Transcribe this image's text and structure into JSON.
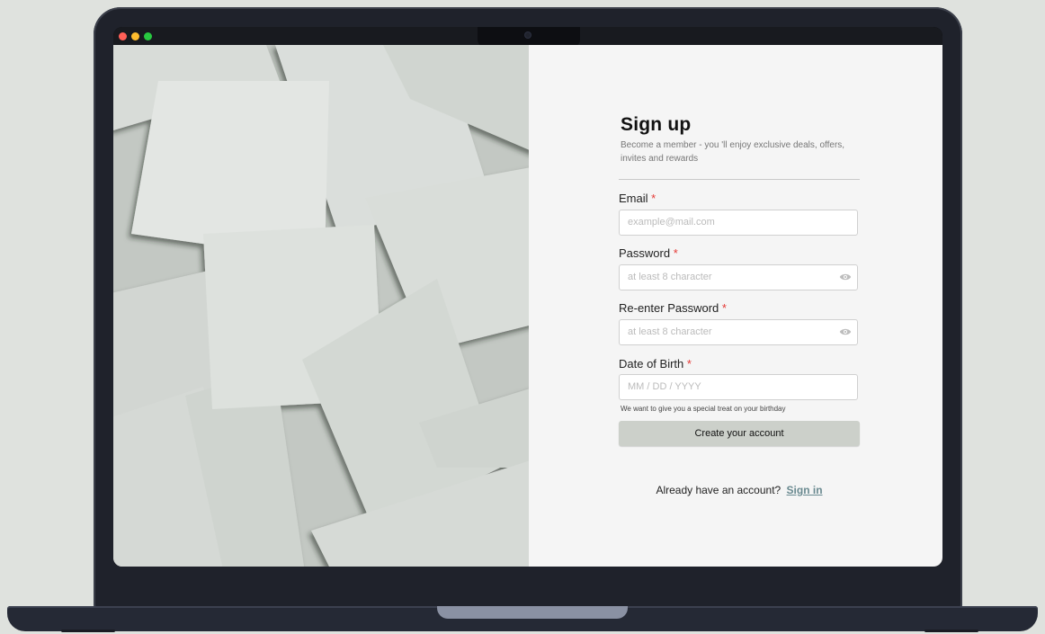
{
  "window": {
    "controls": [
      "close",
      "minimize",
      "maximize"
    ]
  },
  "form": {
    "title": "Sign up",
    "subtitle": "Become a member  - you 'll enjoy exclusive deals, offers, invites and rewards",
    "required_mark": "*",
    "email": {
      "label": "Email",
      "placeholder": "example@mail.com"
    },
    "password": {
      "label": "Password",
      "placeholder": "at least 8 character"
    },
    "reenter_password": {
      "label": "Re-enter Password",
      "placeholder": "at least 8 character"
    },
    "date_of_birth": {
      "label": "Date of Birth",
      "placeholder": "MM / DD / YYYY"
    },
    "birthday_hint": "We want to give you a special treat on your birthday",
    "submit_label": "Create your account",
    "signin_prompt": "Already have an account?",
    "signin_link": "Sign in"
  },
  "colors": {
    "accent": "#6a8a90",
    "required": "#e53935",
    "button": "#ccd0ca"
  },
  "icons": [
    "eye-icon",
    "eye-icon"
  ]
}
